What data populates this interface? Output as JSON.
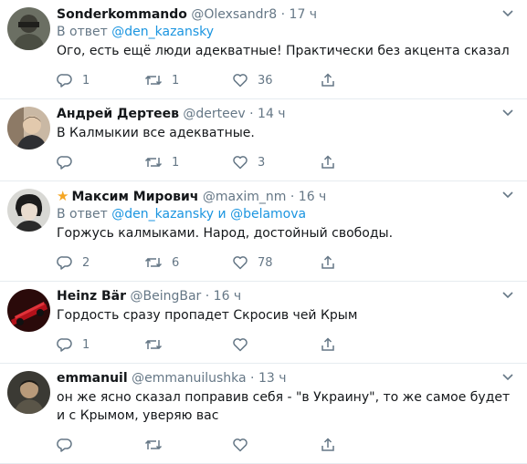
{
  "tweets": [
    {
      "name": "Sonderkommando",
      "star": false,
      "handle": "@Olexsandr8",
      "time": "17 ч",
      "reply_prefix": "В ответ",
      "mentions": [
        "@den_kazansky"
      ],
      "reply_join": "",
      "text": "Ого, есть ещё люди адекватные! Практически без акцента сказал",
      "replies": "1",
      "retweets": "1",
      "likes": "36"
    },
    {
      "name": "Андрей Дертеев",
      "star": false,
      "handle": "@derteev",
      "time": "14 ч",
      "reply_prefix": "",
      "mentions": [],
      "reply_join": "",
      "text": "В Калмыкии все адекватные.",
      "replies": "",
      "retweets": "1",
      "likes": "3"
    },
    {
      "name": "Максим Мирович",
      "star": true,
      "handle": "@maxim_nm",
      "time": "16 ч",
      "reply_prefix": "В ответ",
      "mentions": [
        "@den_kazansky",
        "@belamova"
      ],
      "reply_join": "и",
      "text": "Горжусь калмыками. Народ, достойный свободы.",
      "replies": "2",
      "retweets": "6",
      "likes": "78"
    },
    {
      "name": "Heinz Bär",
      "star": false,
      "handle": "@BeingBar",
      "time": "16 ч",
      "reply_prefix": "",
      "mentions": [],
      "reply_join": "",
      "text": "Гордость сразу пропадет Скросив чей Крым",
      "replies": "1",
      "retweets": "",
      "likes": ""
    },
    {
      "name": "emmanuil",
      "star": false,
      "handle": "@emmanuilushka",
      "time": "13 ч",
      "reply_prefix": "",
      "mentions": [],
      "reply_join": "",
      "text": "он же ясно сказал поправив себя - \"в Украину\", то же самое будет и с Крымом, уверяю вас",
      "replies": "",
      "retweets": "",
      "likes": ""
    }
  ],
  "separator": "·",
  "icons": {
    "reply": "reply-icon",
    "retweet": "retweet-icon",
    "like": "heart-icon",
    "share": "share-icon",
    "menu": "chevron-down-icon",
    "verified_star": "star-icon"
  },
  "colors": {
    "text": "#14171a",
    "secondary": "#657786",
    "link": "#1b95e0",
    "star": "#f5a623",
    "divider": "#e6ecf0"
  }
}
